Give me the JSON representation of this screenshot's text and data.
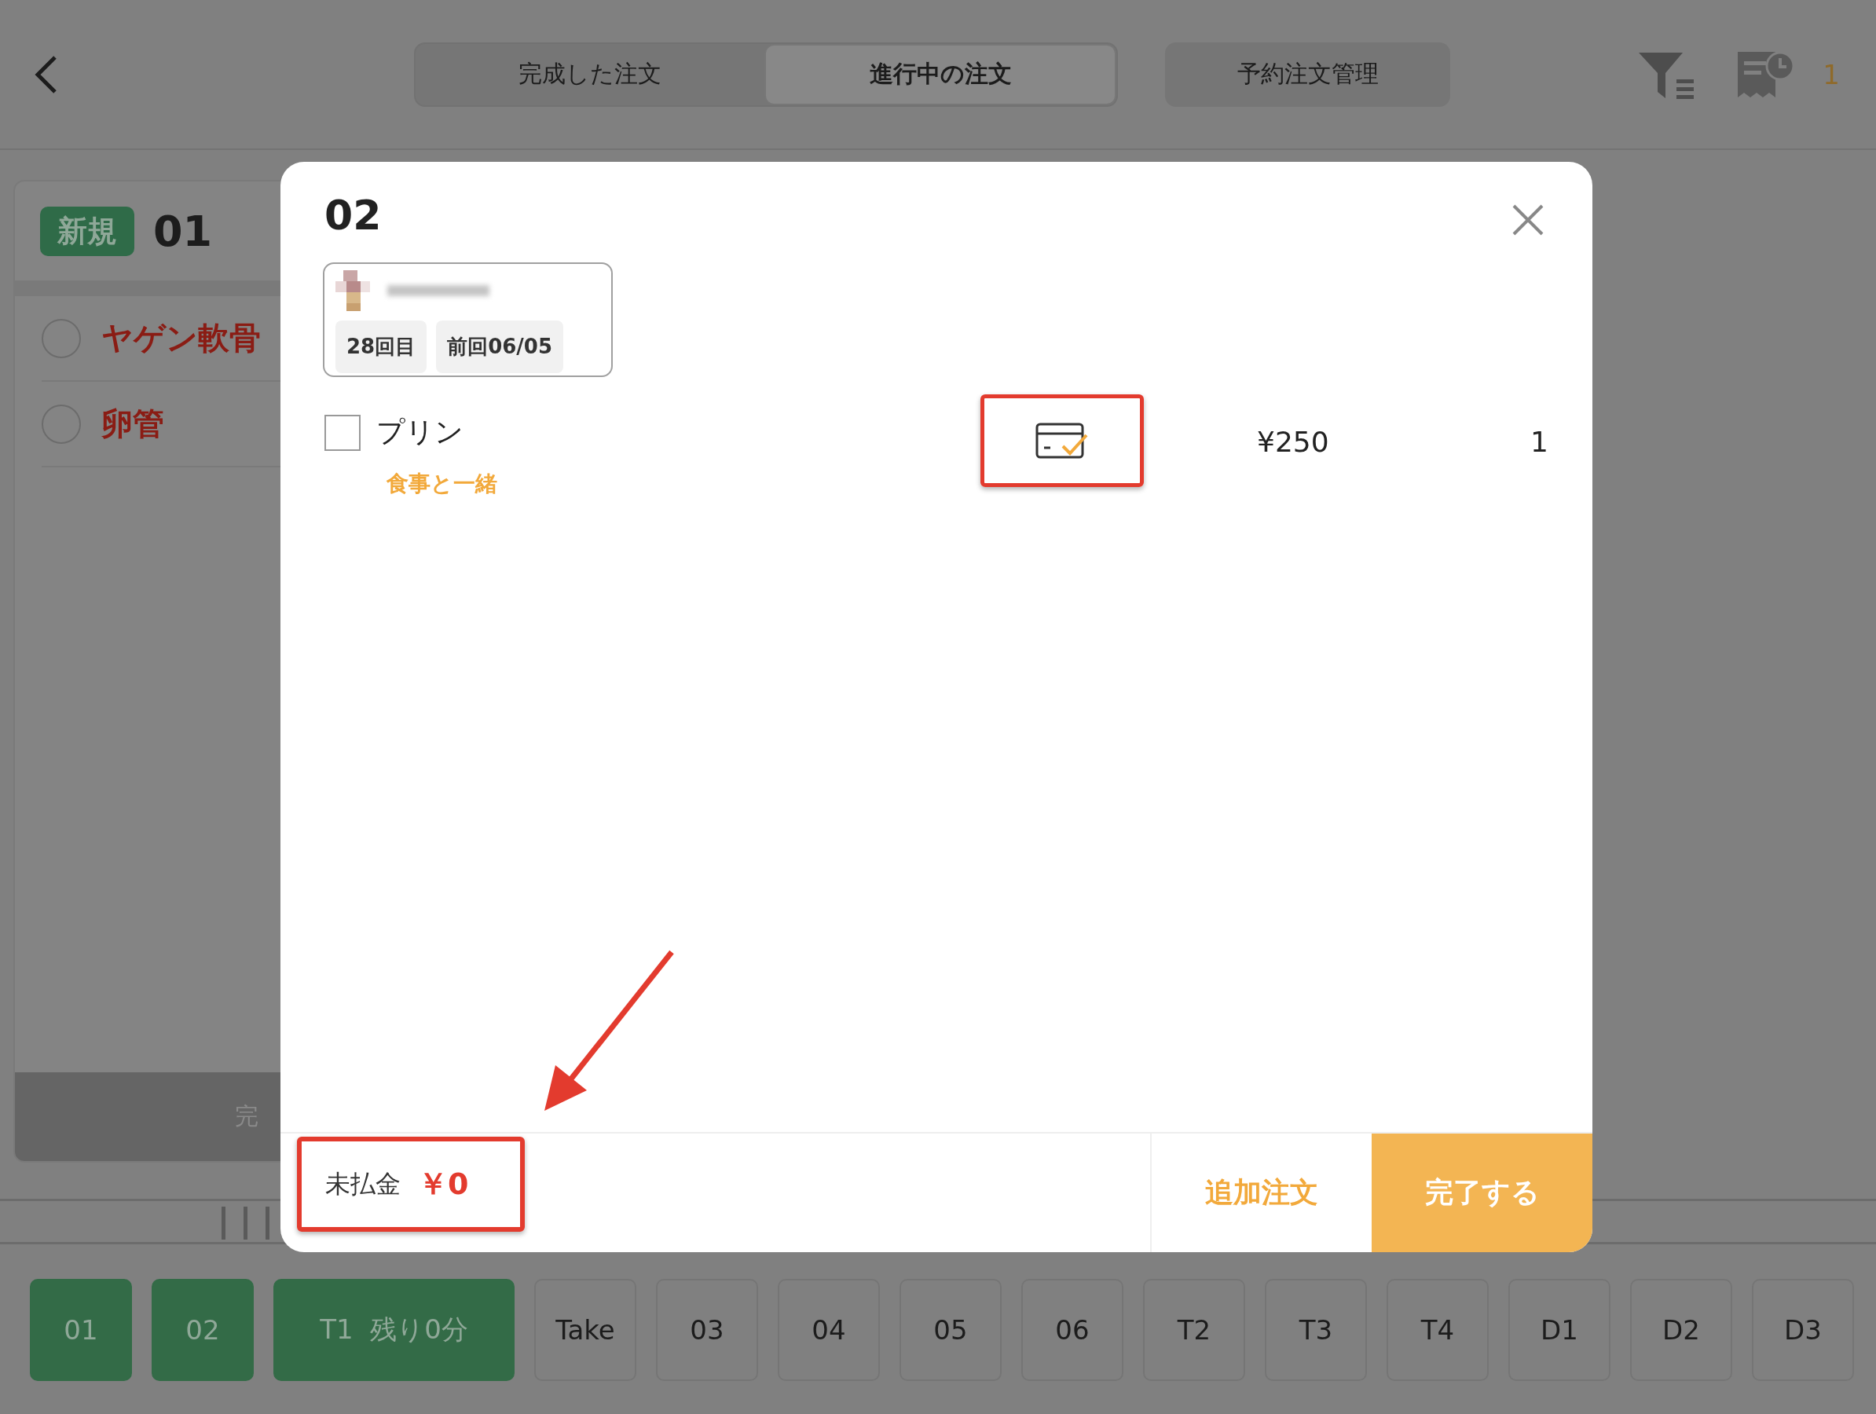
{
  "top_bar": {
    "tabs": [
      {
        "label": "完成した注文",
        "selected": false
      },
      {
        "label": "進行中の注文",
        "selected": true
      }
    ],
    "reservation_button": "予約注文管理",
    "notification_count": "1"
  },
  "order_card": {
    "badge": "新規",
    "number": "01",
    "items": [
      {
        "name": "ヤゲン軟骨",
        "checked": false
      },
      {
        "name": "卵管",
        "checked": false
      }
    ],
    "complete_button": "完"
  },
  "tables": [
    {
      "label": "01",
      "occupied": true
    },
    {
      "label": "02",
      "occupied": true
    },
    {
      "label": "T1  残り0分",
      "occupied": true
    },
    {
      "label": "Take",
      "occupied": false
    },
    {
      "label": "03",
      "occupied": false
    },
    {
      "label": "04",
      "occupied": false
    },
    {
      "label": "05",
      "occupied": false
    },
    {
      "label": "06",
      "occupied": false
    },
    {
      "label": "T2",
      "occupied": false
    },
    {
      "label": "T3",
      "occupied": false
    },
    {
      "label": "T4",
      "occupied": false
    },
    {
      "label": "D1",
      "occupied": false
    },
    {
      "label": "D2",
      "occupied": false
    },
    {
      "label": "D3",
      "occupied": false
    }
  ],
  "dialog": {
    "title": "02",
    "customer": {
      "visits": "28回目",
      "last_visit": "前回06/05"
    },
    "items": [
      {
        "checked": false,
        "name": "プリン",
        "note": "食事と一緒",
        "price": "¥250",
        "quantity": "1"
      }
    ],
    "unpaid_label": "未払金",
    "unpaid_amount": "￥0",
    "add_order_button": "追加注文",
    "complete_button": "完了する"
  }
}
